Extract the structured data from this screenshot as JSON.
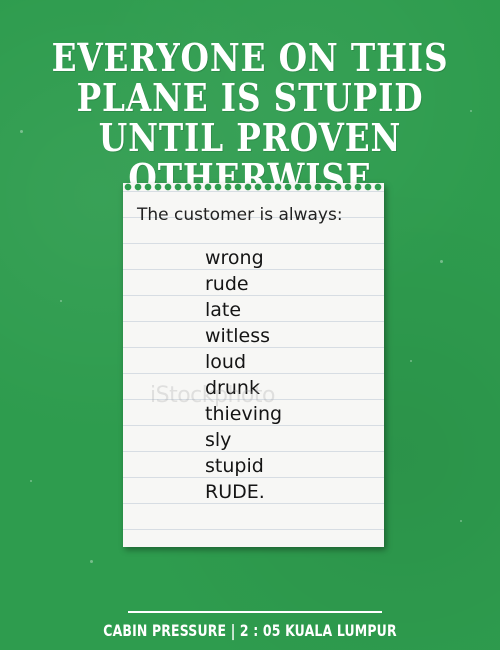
{
  "headline": {
    "lines": [
      "EVERYONE ON THIS",
      "PLANE IS STUPID",
      "UNTIL PROVEN OTHERWISE"
    ]
  },
  "note": {
    "intro": "The customer is always:",
    "items": [
      "wrong",
      "rude",
      "late",
      "witless",
      "loud",
      "drunk",
      "thieving",
      "sly",
      "stupid",
      "RUDE."
    ]
  },
  "watermark": "iStockphoto",
  "footer": "CABIN PRESSURE | 2 : 05 KUALA LUMPUR",
  "colors": {
    "background": "#2e9c4e",
    "paper": "#f7f7f5",
    "text_light": "#ffffff",
    "ink": "#151515"
  }
}
